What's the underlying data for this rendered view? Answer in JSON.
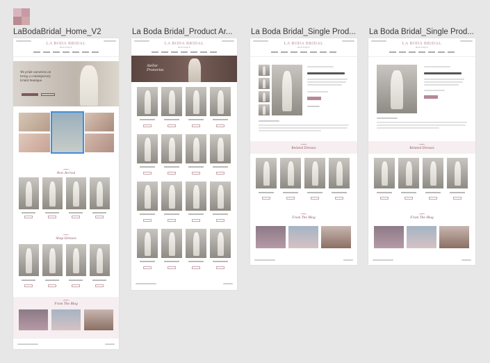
{
  "canvas": {
    "background": "#e7e7e7"
  },
  "swatches": [
    "#d8b4bf",
    "#c79aa6",
    "#b98a8f",
    "#cfa7a8"
  ],
  "frames": [
    {
      "title": "LaBodaBridal_Home_V2"
    },
    {
      "title": "La Boda Bridal_Product Ar..."
    },
    {
      "title": "La Boda Bridal_Single Prod..."
    },
    {
      "title": "La Boda Bridal_Single Prod..."
    }
  ],
  "colors": {
    "accent": "#b58a94",
    "selection": "#3d8ee0",
    "hero_band": "#5a4540"
  }
}
